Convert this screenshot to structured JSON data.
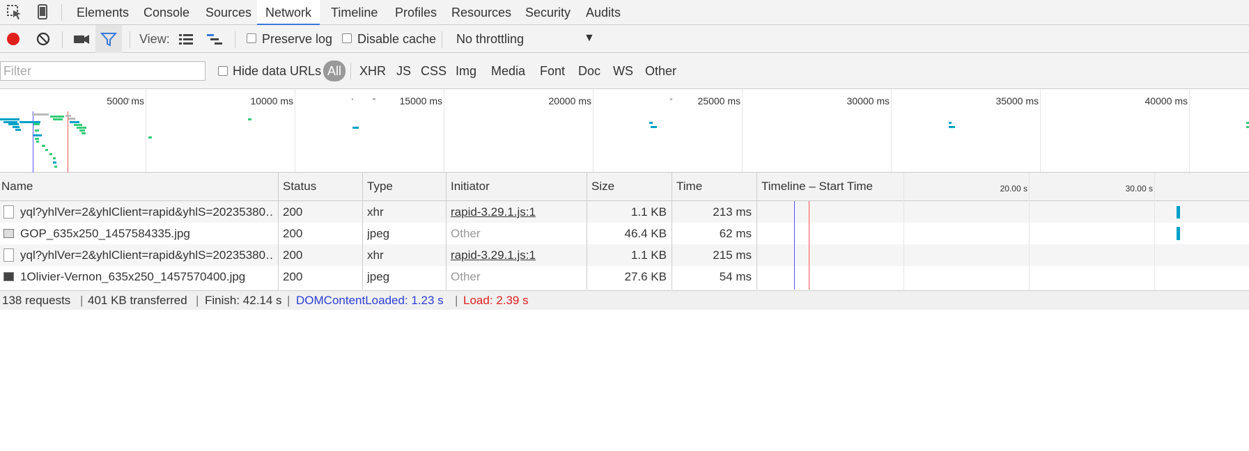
{
  "tabs": {
    "items": [
      "Elements",
      "Console",
      "Sources",
      "Network",
      "Timeline",
      "Profiles",
      "Resources",
      "Security",
      "Audits"
    ],
    "active": "Network"
  },
  "toolbar": {
    "view_label": "View:",
    "preserve_log": "Preserve log",
    "disable_cache": "Disable cache",
    "throttling": "No throttling"
  },
  "filterbar": {
    "placeholder": "Filter",
    "hide_data_urls": "Hide data URLs",
    "types": [
      "All",
      "XHR",
      "JS",
      "CSS",
      "Img",
      "Media",
      "Font",
      "Doc",
      "WS",
      "Other"
    ],
    "active_type": "All"
  },
  "overview": {
    "labels": [
      "5000 ms",
      "10000 ms",
      "15000 ms",
      "20000 ms",
      "25000 ms",
      "30000 ms",
      "35000 ms",
      "40000 ms"
    ]
  },
  "table": {
    "columns": [
      "Name",
      "Status",
      "Type",
      "Initiator",
      "Size",
      "Time",
      "Timeline – Start Time"
    ],
    "scale_labels": [
      "20.00 s",
      "30.00 s"
    ],
    "rows": [
      {
        "name": "yql?yhlVer=2&yhlClient=rapid&yhlS=20235380…",
        "status": "200",
        "type": "xhr",
        "initiator": "rapid-3.29.1.js:1",
        "size": "1.1 KB",
        "time": "213 ms"
      },
      {
        "name": "GOP_635x250_1457584335.jpg",
        "status": "200",
        "type": "jpeg",
        "initiator": "Other",
        "size": "46.4 KB",
        "time": "62 ms"
      },
      {
        "name": "yql?yhlVer=2&yhlClient=rapid&yhlS=20235380…",
        "status": "200",
        "type": "xhr",
        "initiator": "rapid-3.29.1.js:1",
        "size": "1.1 KB",
        "time": "215 ms"
      },
      {
        "name": "1Olivier-Vernon_635x250_1457570400.jpg",
        "status": "200",
        "type": "jpeg",
        "initiator": "Other",
        "size": "27.6 KB",
        "time": "54 ms"
      }
    ]
  },
  "statusbar": {
    "requests": "138 requests",
    "transferred": "401 KB transferred",
    "finish": "Finish: 42.14 s",
    "dom_loaded": "DOMContentLoaded: 1.23 s",
    "load": "Load: 2.39 s"
  },
  "colors": {
    "accent": "#3879d9",
    "record": "#e0201b",
    "dom_line": "#5555ff",
    "load_line": "#ff5555",
    "bar_teal": "#00a0c8",
    "bar_green": "#33cc77"
  }
}
